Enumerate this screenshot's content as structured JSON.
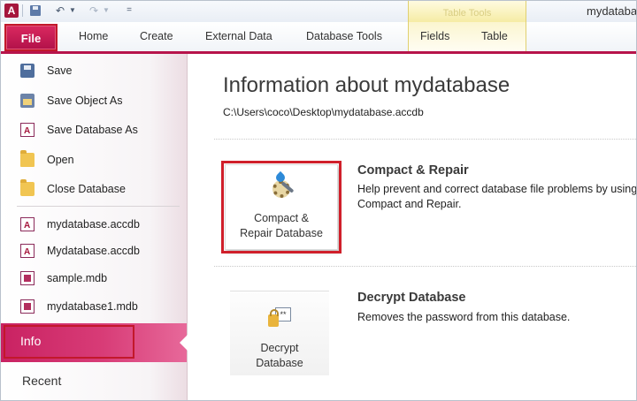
{
  "window": {
    "title": "mydatabase",
    "app_icon": "A",
    "context_tab_group": "Table Tools"
  },
  "quick_access": {
    "customize_icon": "="
  },
  "ribbon": {
    "file_tab": "File",
    "tabs": [
      "Home",
      "Create",
      "External Data",
      "Database Tools",
      "Fields",
      "Table"
    ],
    "accent_color": "#b7144b"
  },
  "backstage_nav": {
    "commands": [
      {
        "label": "Save",
        "icon": "save-icon"
      },
      {
        "label": "Save Object As",
        "icon": "save-object-icon"
      },
      {
        "label": "Save Database As",
        "icon": "save-database-icon"
      },
      {
        "label": "Open",
        "icon": "open-folder-icon"
      },
      {
        "label": "Close Database",
        "icon": "close-database-icon"
      }
    ],
    "recent_files": [
      {
        "label": "mydatabase.accdb",
        "icon": "accdb-file-icon"
      },
      {
        "label": "Mydatabase.accdb",
        "icon": "accdb-file-icon"
      },
      {
        "label": "sample.mdb",
        "icon": "mdb-file-icon"
      },
      {
        "label": "mydatabase1.mdb",
        "icon": "mdb-file-icon"
      }
    ],
    "info": "Info",
    "recent": "Recent",
    "selected": "Info"
  },
  "info_page": {
    "title": "Information about mydatabase",
    "path": "C:\\Users\\coco\\Desktop\\mydatabase.accdb",
    "compact": {
      "button_line1": "Compact &",
      "button_line2": "Repair Database",
      "heading": "Compact & Repair",
      "description": "Help prevent and correct database file problems by using Compact and Repair.",
      "icon": "compact-repair-icon"
    },
    "decrypt": {
      "button_line1": "Decrypt",
      "button_line2": "Database",
      "heading": "Decrypt Database",
      "description": "Removes the password from this database.",
      "icon": "decrypt-database-icon"
    }
  }
}
